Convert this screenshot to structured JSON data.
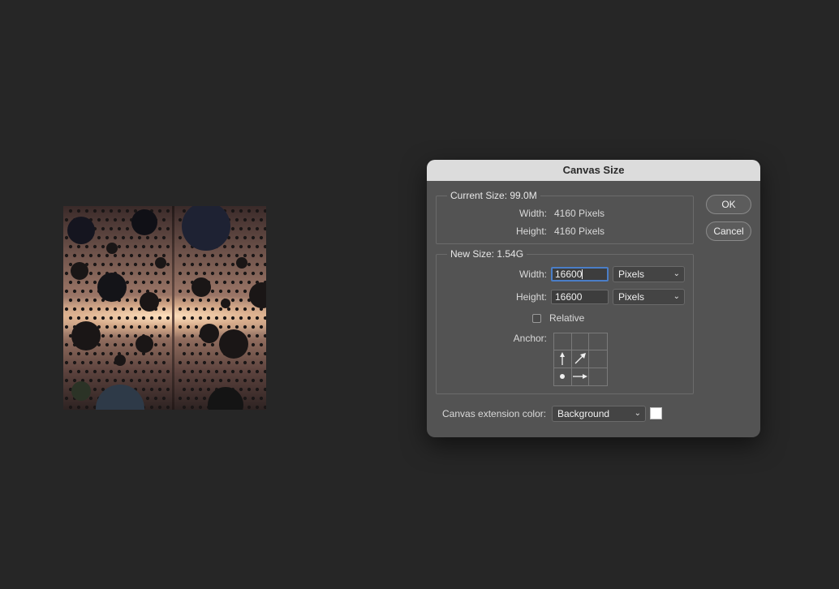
{
  "dialog": {
    "title": "Canvas Size",
    "current_size": {
      "title": "Current Size: 99.0M",
      "width_label": "Width:",
      "width_value": "4160 Pixels",
      "height_label": "Height:",
      "height_value": "4160 Pixels"
    },
    "new_size": {
      "title": "New Size: 1.54G",
      "width_label": "Width:",
      "width_value": "16600",
      "width_unit": "Pixels",
      "height_label": "Height:",
      "height_value": "16600",
      "height_unit": "Pixels",
      "relative_label": "Relative",
      "relative_checked": false,
      "anchor_label": "Anchor:",
      "anchor_cells": [
        {
          "icon": "empty"
        },
        {
          "icon": "empty"
        },
        {
          "icon": "empty"
        },
        {
          "icon": "arrow-up-icon"
        },
        {
          "icon": "arrow-up-right-icon"
        },
        {
          "icon": "empty"
        },
        {
          "icon": "anchor-dot-icon"
        },
        {
          "icon": "arrow-right-icon"
        },
        {
          "icon": "empty"
        }
      ]
    },
    "extension_color_label": "Canvas extension color:",
    "extension_color_value": "Background",
    "extension_swatch_color": "#ffffff",
    "ok_label": "OK",
    "cancel_label": "Cancel"
  },
  "colors": {
    "app_background": "#262626",
    "dialog_background": "#535353",
    "titlebar": "#dcdcdc",
    "focus_ring": "#4a7ec7"
  }
}
